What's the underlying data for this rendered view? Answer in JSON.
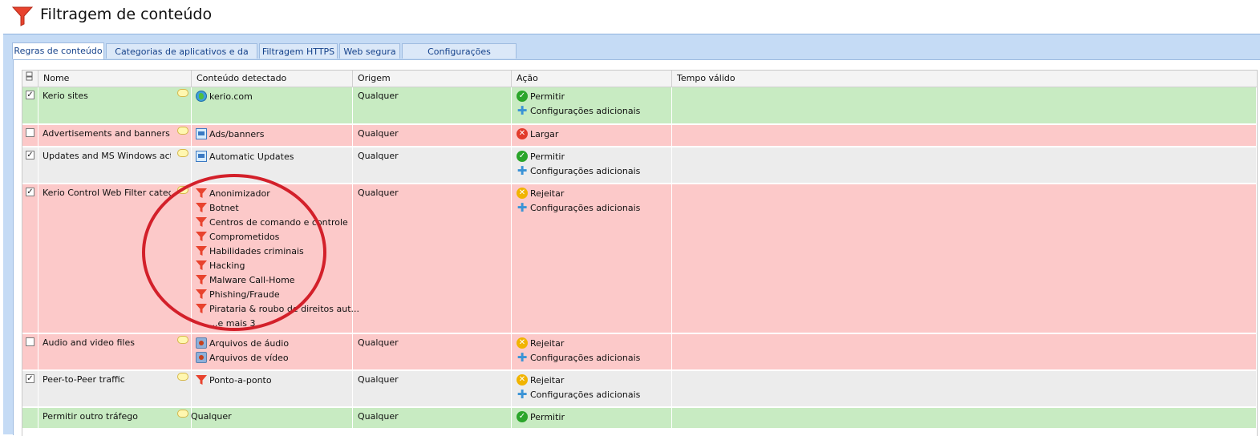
{
  "window": {
    "title": "Filtragem de conteúdo",
    "icon": "funnel-icon"
  },
  "tabs": [
    {
      "label": "Regras de conteúdo",
      "active": true
    },
    {
      "label": "Categorias de aplicativos e da web",
      "active": false
    },
    {
      "label": "Filtragem HTTPS",
      "active": false
    },
    {
      "label": "Web segura",
      "active": false
    },
    {
      "label": "Configurações avançadas",
      "active": false
    }
  ],
  "grid": {
    "columns": [
      "Nome",
      "Conteúdo detectado",
      "Origem",
      "Ação",
      "Tempo válido"
    ],
    "rows": [
      {
        "checked": true,
        "name": "Kerio sites",
        "color": "green",
        "content": [
          {
            "icon": "globe-icon",
            "label": "kerio.com"
          }
        ],
        "origin": "Qualquer",
        "actions": [
          {
            "icon": "check-icon",
            "label": "Permitir"
          },
          {
            "icon": "plus-icon",
            "label": "Configurações adicionais"
          }
        ],
        "time": ""
      },
      {
        "checked": false,
        "name": "Advertisements and banners",
        "color": "red",
        "content": [
          {
            "icon": "ads-icon",
            "label": "Ads/banners"
          }
        ],
        "origin": "Qualquer",
        "actions": [
          {
            "icon": "drop-icon",
            "label": "Largar"
          }
        ],
        "time": ""
      },
      {
        "checked": true,
        "name": "Updates and MS Windows activ...",
        "color": "gray",
        "content": [
          {
            "icon": "ads-icon",
            "label": "Automatic Updates"
          }
        ],
        "origin": "Qualquer",
        "actions": [
          {
            "icon": "check-icon",
            "label": "Permitir"
          },
          {
            "icon": "plus-icon",
            "label": "Configurações adicionais"
          }
        ],
        "time": ""
      },
      {
        "checked": true,
        "name": "Kerio Control Web Filter catego...",
        "color": "red",
        "content": [
          {
            "icon": "funnel-icon",
            "label": "Anonimizador"
          },
          {
            "icon": "funnel-icon",
            "label": "Botnet"
          },
          {
            "icon": "funnel-icon",
            "label": "Centros de comando e controle"
          },
          {
            "icon": "funnel-icon",
            "label": "Comprometidos"
          },
          {
            "icon": "funnel-icon",
            "label": "Habilidades criminais"
          },
          {
            "icon": "funnel-icon",
            "label": "Hacking"
          },
          {
            "icon": "funnel-icon",
            "label": "Malware Call-Home"
          },
          {
            "icon": "funnel-icon",
            "label": "Phishing/Fraude"
          },
          {
            "icon": "funnel-icon",
            "label": "Pirataria & roubo de direitos aut..."
          },
          {
            "icon": "",
            "label": "...e mais 3"
          }
        ],
        "origin": "Qualquer",
        "actions": [
          {
            "icon": "reject-icon",
            "label": "Rejeitar"
          },
          {
            "icon": "plus-icon",
            "label": "Configurações adicionais"
          }
        ],
        "time": ""
      },
      {
        "checked": false,
        "name": "Audio and video files",
        "color": "red",
        "content": [
          {
            "icon": "media-icon",
            "label": "Arquivos de áudio"
          },
          {
            "icon": "media-icon",
            "label": "Arquivos de vídeo"
          }
        ],
        "origin": "Qualquer",
        "actions": [
          {
            "icon": "reject-icon",
            "label": "Rejeitar"
          },
          {
            "icon": "plus-icon",
            "label": "Configurações adicionais"
          }
        ],
        "time": ""
      },
      {
        "checked": true,
        "name": "Peer-to-Peer traffic",
        "color": "gray",
        "content": [
          {
            "icon": "funnel-icon",
            "label": "Ponto-a-ponto"
          }
        ],
        "origin": "Qualquer",
        "actions": [
          {
            "icon": "reject-icon",
            "label": "Rejeitar"
          },
          {
            "icon": "plus-icon",
            "label": "Configurações adicionais"
          }
        ],
        "time": ""
      },
      {
        "checked": null,
        "name": "Permitir outro tráfego",
        "color": "green",
        "content": [
          {
            "icon": "",
            "label": "Qualquer"
          }
        ],
        "origin": "Qualquer",
        "actions": [
          {
            "icon": "check-icon",
            "label": "Permitir"
          }
        ],
        "time": ""
      }
    ]
  },
  "colors": {
    "allow_row": "#c8ebc2",
    "deny_row": "#fcc9c9",
    "disabled_row": "#ececec",
    "annotation_circle": "#d3202a",
    "brand_funnel": "#e8432e"
  }
}
